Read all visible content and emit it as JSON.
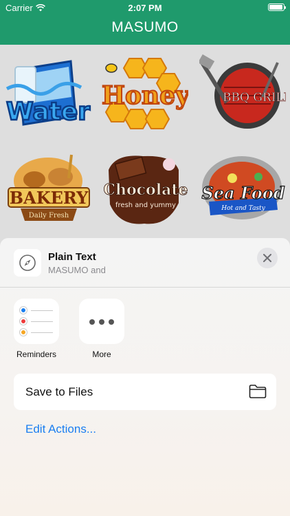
{
  "status": {
    "carrier": "Carrier",
    "time": "2:07 PM"
  },
  "nav": {
    "title": "MASUMO"
  },
  "stickers": [
    {
      "icon": "water-sticker-icon",
      "text": "Water"
    },
    {
      "icon": "honey-sticker-icon",
      "text": "Honey"
    },
    {
      "icon": "bbq-grill-sticker-icon",
      "text": "BBQ GRILL"
    },
    {
      "icon": "bakery-sticker-icon",
      "text": "BAKERY",
      "subtext": "Daily Fresh"
    },
    {
      "icon": "chocolate-sticker-icon",
      "text": "Chocolate",
      "subtext": "fresh and yummy"
    },
    {
      "icon": "seafood-sticker-icon",
      "text": "Sea Food",
      "subtext": "Hot and Tasty"
    }
  ],
  "share_sheet": {
    "title": "Plain Text",
    "subtitle": "MASUMO and",
    "apps": [
      {
        "label": "Reminders",
        "icon": "reminders-icon"
      },
      {
        "label": "More",
        "icon": "more-icon"
      }
    ],
    "actions": [
      {
        "label": "Save to Files",
        "icon": "folder-icon"
      }
    ],
    "edit_actions": "Edit Actions..."
  },
  "colors": {
    "nav_bar": "#1f9a6c",
    "link": "#1a7ef0"
  }
}
